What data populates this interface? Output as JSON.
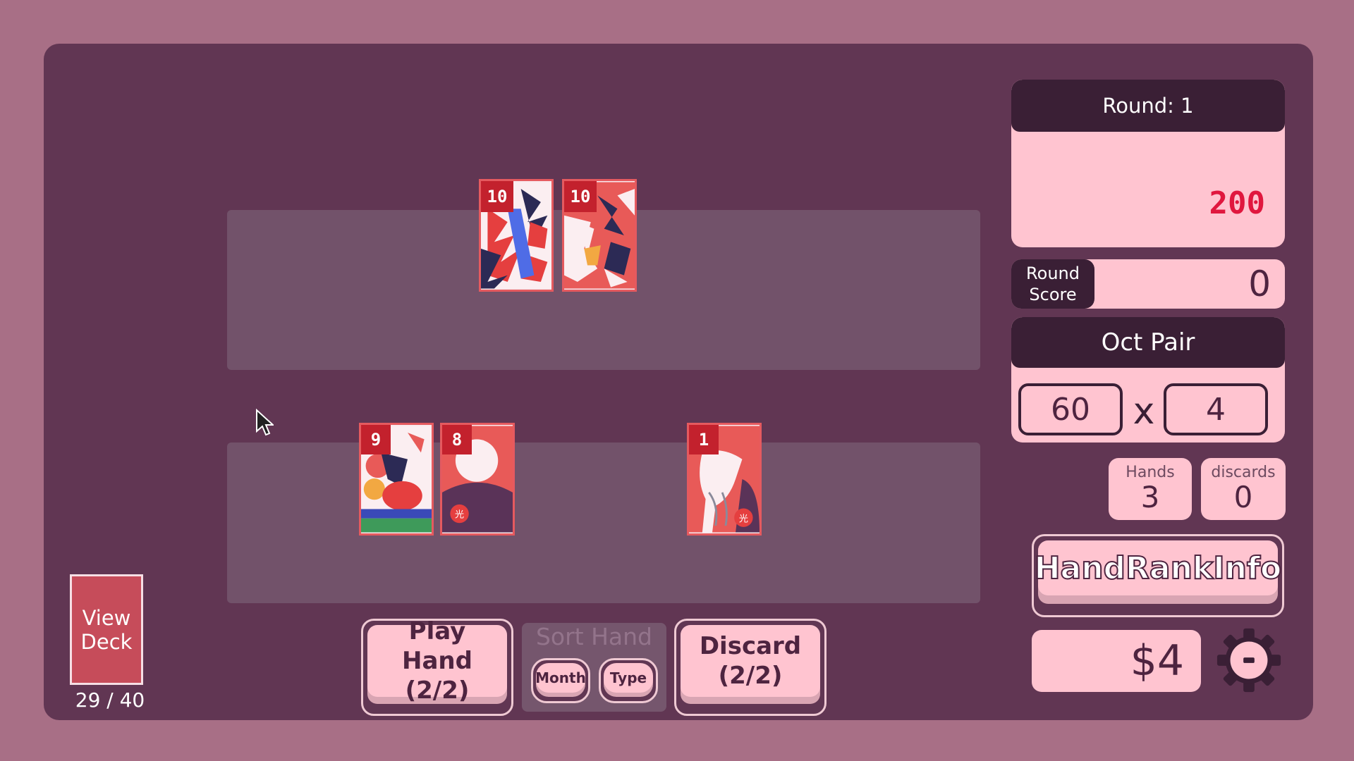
{
  "played_cards": [
    {
      "value": "10",
      "art": "maple-ribbon"
    },
    {
      "value": "10",
      "art": "maple-deer"
    }
  ],
  "hand_cards": [
    {
      "value": "9",
      "art": "chrysanthemum-cup"
    },
    {
      "value": "8",
      "art": "pampas-moon"
    },
    {
      "value": "1",
      "art": "pine-crane"
    }
  ],
  "deck": {
    "label": "View Deck",
    "count": "29 / 40"
  },
  "buttons": {
    "play_hand": "Play Hand (2/2)",
    "discard": "Discard (2/2)",
    "sort_title": "Sort Hand",
    "sort_month": "Month",
    "sort_type": "Type",
    "hand_rank_info": "HandRankInfo"
  },
  "round": {
    "label": "Round: 1",
    "target": "200"
  },
  "round_score": {
    "label": "Round Score",
    "value": "0"
  },
  "hand": {
    "name": "Oct Pair",
    "chips": "60",
    "times": "x",
    "mult": "4"
  },
  "stats": {
    "hands_label": "Hands",
    "hands": "3",
    "discards_label": "discards",
    "discards": "0"
  },
  "money": "$4",
  "icons": {
    "settings": "gear-icon",
    "cursor": "mouse-pointer-icon"
  },
  "colors": {
    "background": "#a86f86",
    "board": "#613653",
    "panel": "#ffc4d0",
    "dark": "#3a1f35",
    "accent_red": "#e0173e",
    "card_number": "#c3212d"
  }
}
